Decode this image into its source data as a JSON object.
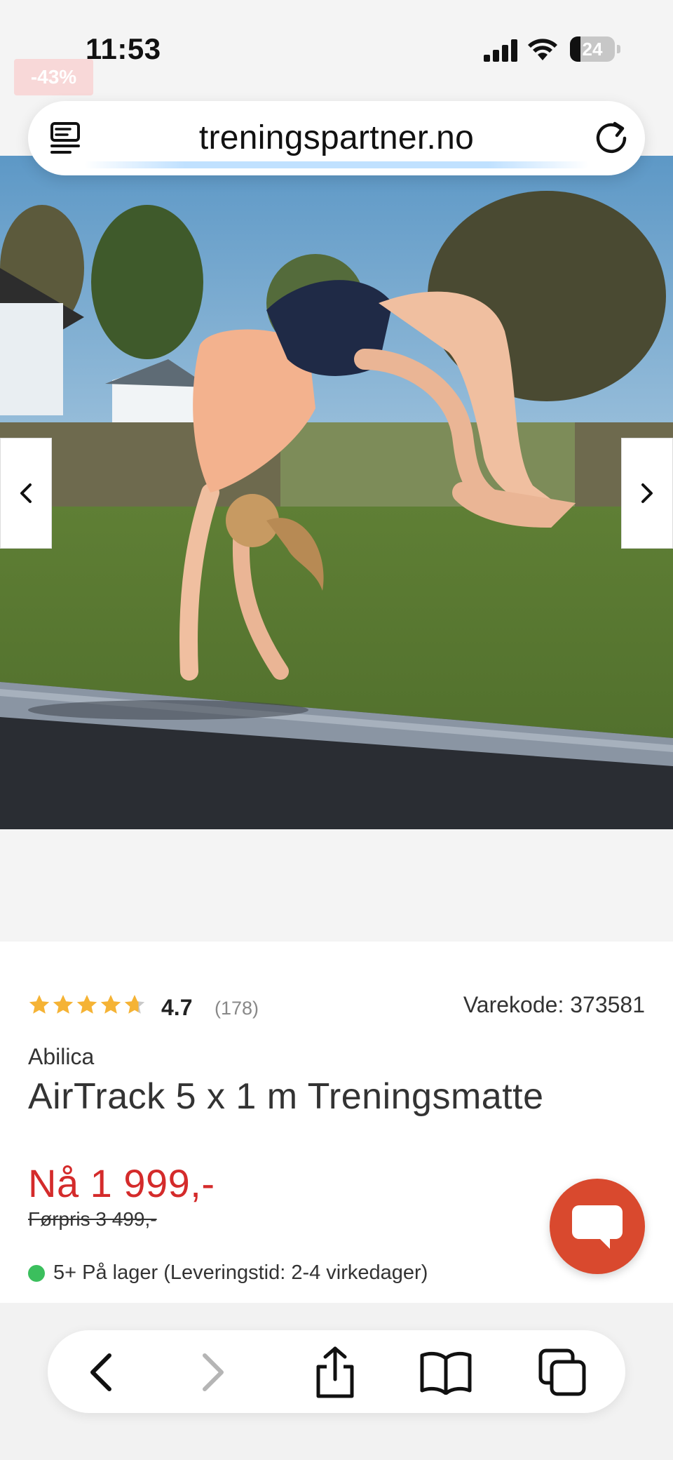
{
  "status_bar": {
    "time": "11:53",
    "battery_level": "24",
    "battery_fraction": 0.24,
    "signal_bars": 4
  },
  "discount_badge": "-43%",
  "browser": {
    "url": "treningspartner.no",
    "reader_icon": "reader-mode-icon",
    "reload_icon": "reload-icon"
  },
  "gallery": {
    "prev_icon": "chevron-left-icon",
    "next_icon": "chevron-right-icon"
  },
  "product": {
    "rating": {
      "stars": 4.7,
      "value": "4.7",
      "count": "(178)"
    },
    "sku": "Varekode: 373581",
    "brand": "Abilica",
    "title": "AirTrack 5 x 1 m Treningsmatte",
    "price_now": "Nå 1 999,-",
    "price_before": "Førpris 3 499,-",
    "stock": "5+ På lager (Leveringstid: 2-4 virkedager)"
  },
  "chat": {
    "icon": "chat-bubble-icon"
  },
  "toolbar": {
    "back_icon": "back-icon",
    "forward_icon": "forward-icon",
    "share_icon": "share-icon",
    "bookmarks_icon": "bookmarks-icon",
    "tabs_icon": "tabs-icon"
  },
  "colors": {
    "price_red": "#d42b2b",
    "star_yellow": "#f5b335",
    "stock_green": "#3bbf5d",
    "chat_orange": "#d9492e"
  }
}
